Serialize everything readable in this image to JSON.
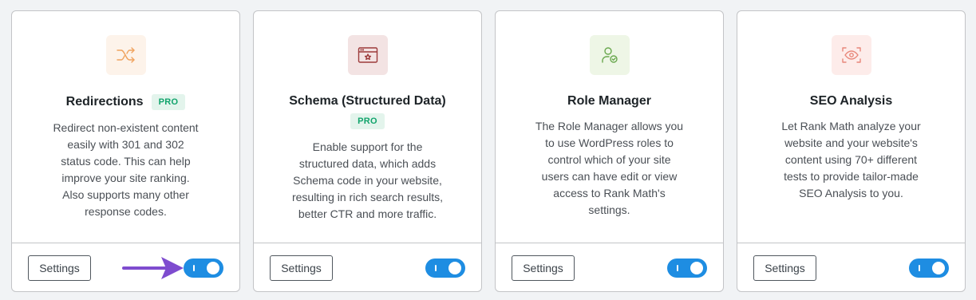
{
  "cards": [
    {
      "title": "Redirections",
      "pro_badge": "PRO",
      "icon": "shuffle-icon",
      "icon_bg": "#fdf3ea",
      "icon_color": "#f0a35e",
      "description": "Redirect non-existent content easily with 301 and 302 status code. This can help improve your site ranking. Also supports many other response codes.",
      "settings_label": "Settings",
      "enabled": true
    },
    {
      "title": "Schema (Structured Data)",
      "pro_badge": "PRO",
      "icon": "schema-browser-icon",
      "icon_bg": "#f3e3e3",
      "icon_color": "#9c3a3a",
      "description": "Enable support for the structured data, which adds Schema code in your website, resulting in rich search results, better CTR and more traffic.",
      "settings_label": "Settings",
      "enabled": true
    },
    {
      "title": "Role Manager",
      "icon": "user-check-icon",
      "icon_bg": "#eef6e6",
      "icon_color": "#6aa84f",
      "description": "The Role Manager allows you to use WordPress roles to control which of your site users can have edit or view access to Rank Math's settings.",
      "settings_label": "Settings",
      "enabled": true
    },
    {
      "title": "SEO Analysis",
      "icon": "eye-scan-icon",
      "icon_bg": "#fdecea",
      "icon_color": "#e8877a",
      "description": "Let Rank Math analyze your website and your website's content using 70+ different tests to provide tailor-made SEO Analysis to you.",
      "settings_label": "Settings",
      "enabled": true
    }
  ],
  "colors": {
    "toggle_on": "#1e8de2",
    "pro_badge_bg": "#e3f4ec",
    "pro_badge_text": "#10a36b",
    "arrow": "#7e4ccf"
  }
}
